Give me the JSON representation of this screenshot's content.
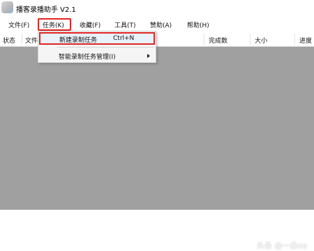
{
  "window": {
    "title": "播客录播助手 V2.1"
  },
  "menubar": {
    "items": [
      {
        "label": "文件(F)"
      },
      {
        "label": "任务(K)"
      },
      {
        "label": "收藏(F)"
      },
      {
        "label": "工具(T)"
      },
      {
        "label": "赞助(A)"
      },
      {
        "label": "帮助(H)"
      }
    ]
  },
  "table": {
    "columns": [
      "状态",
      "文件",
      "完成数",
      "大小",
      "进度"
    ]
  },
  "task_menu": {
    "items": [
      {
        "label": "新建录制任务",
        "shortcut": "Ctrl+N"
      },
      {
        "label": "智能录制任务管理(I)"
      }
    ]
  },
  "watermark": {
    "text": "头条 @一朵oo"
  },
  "colors": {
    "highlight": "#e02424",
    "content_bg": "#a0a0a0",
    "menu_bg": "#f5f5f5"
  }
}
